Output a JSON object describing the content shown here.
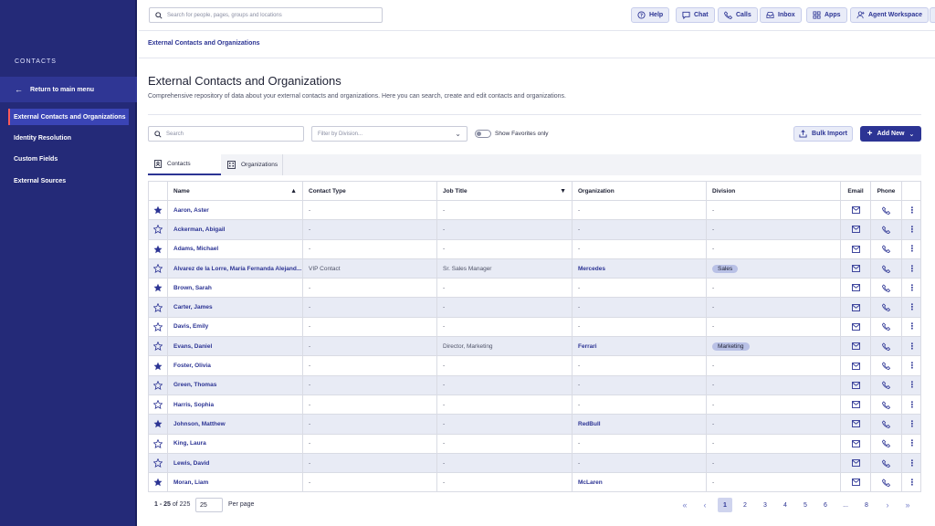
{
  "sidebar": {
    "title": "CONTACTS",
    "return_label": "Return to main menu",
    "items": [
      {
        "label": "External Contacts and Organizations"
      },
      {
        "label": "Identity Resolution"
      },
      {
        "label": "Custom Fields"
      },
      {
        "label": "External Sources"
      }
    ]
  },
  "topbar": {
    "search_placeholder": "Search for people, pages, groups and locations",
    "buttons": [
      {
        "label": "Help",
        "icon": "help-icon"
      },
      {
        "label": "Chat",
        "icon": "chat-icon"
      },
      {
        "label": "Calls",
        "icon": "phone-icon"
      },
      {
        "label": "Inbox",
        "icon": "inbox-icon"
      },
      {
        "label": "Apps",
        "icon": "apps-icon"
      },
      {
        "label": "Agent Workspace",
        "icon": "agent-icon"
      }
    ]
  },
  "breadcrumb": "External Contacts and Organizations",
  "page": {
    "title": "External Contacts and Organizations",
    "description": "Comprehensive repository of data about your external contacts and organizations. Here you can search, create and edit contacts and organizations."
  },
  "filters": {
    "search_placeholder": "Search",
    "division_placeholder": "Filter by Division...",
    "favorites_label": "Show Favorites only",
    "bulk_import_label": "Bulk Import",
    "add_new_label": "Add New"
  },
  "tabs": [
    {
      "label": "Contacts"
    },
    {
      "label": "Organizations"
    }
  ],
  "table": {
    "columns": {
      "name": "Name",
      "type": "Contact Type",
      "job": "Job Title",
      "org": "Organization",
      "division": "Division",
      "email": "Email",
      "phone": "Phone"
    },
    "rows": [
      {
        "name": "Aaron, Aster",
        "type": "-",
        "job": "-",
        "org": "-",
        "division": "-",
        "favorite": true
      },
      {
        "name": "Ackerman, Abigail",
        "type": "-",
        "job": "-",
        "org": "-",
        "division": "-",
        "favorite": false
      },
      {
        "name": "Adams, Michael",
        "type": "-",
        "job": "-",
        "org": "-",
        "division": "-",
        "favorite": true
      },
      {
        "name": "Alvarez de la Lorre, María Fernanda Alejand...",
        "type": "VIP Contact",
        "job": "Sr. Sales Manager",
        "org": "Mercedes",
        "division": "Sales",
        "favorite": false
      },
      {
        "name": "Brown, Sarah",
        "type": "-",
        "job": "-",
        "org": "-",
        "division": "-",
        "favorite": true
      },
      {
        "name": "Carter, James",
        "type": "-",
        "job": "-",
        "org": "-",
        "division": "-",
        "favorite": false
      },
      {
        "name": "Davis, Emily",
        "type": "-",
        "job": "-",
        "org": "-",
        "division": "-",
        "favorite": false
      },
      {
        "name": "Evans, Daniel",
        "type": "-",
        "job": "Director, Marketing",
        "org": "Ferrari",
        "division": "Marketing",
        "favorite": false
      },
      {
        "name": "Foster, Olivia",
        "type": "-",
        "job": "-",
        "org": "-",
        "division": "-",
        "favorite": true
      },
      {
        "name": "Green, Thomas",
        "type": "-",
        "job": "-",
        "org": "-",
        "division": "-",
        "favorite": false
      },
      {
        "name": "Harris, Sophia",
        "type": "-",
        "job": "-",
        "org": "-",
        "division": "-",
        "favorite": false
      },
      {
        "name": "Johnson, Matthew",
        "type": "-",
        "job": "-",
        "org": "RedBull",
        "division": "-",
        "favorite": true
      },
      {
        "name": "King, Laura",
        "type": "-",
        "job": "-",
        "org": "-",
        "division": "-",
        "favorite": false
      },
      {
        "name": "Lewis, David",
        "type": "-",
        "job": "-",
        "org": "-",
        "division": "-",
        "favorite": false
      },
      {
        "name": "Moran, Liam",
        "type": "-",
        "job": "-",
        "org": "McLaren",
        "division": "-",
        "favorite": true
      }
    ]
  },
  "pagination": {
    "range": "1 - 25",
    "of_label": "of",
    "total": "225",
    "per_page_value": "25",
    "per_page_label": "Per page",
    "pages": [
      "1",
      "2",
      "3",
      "4",
      "5",
      "6",
      "...",
      "8"
    ],
    "current": "1"
  },
  "colors": {
    "sidebar": "#242a78",
    "accent": "#2c3494",
    "row_shade": "#e8ebf5",
    "pill": "#b9c1e6"
  }
}
